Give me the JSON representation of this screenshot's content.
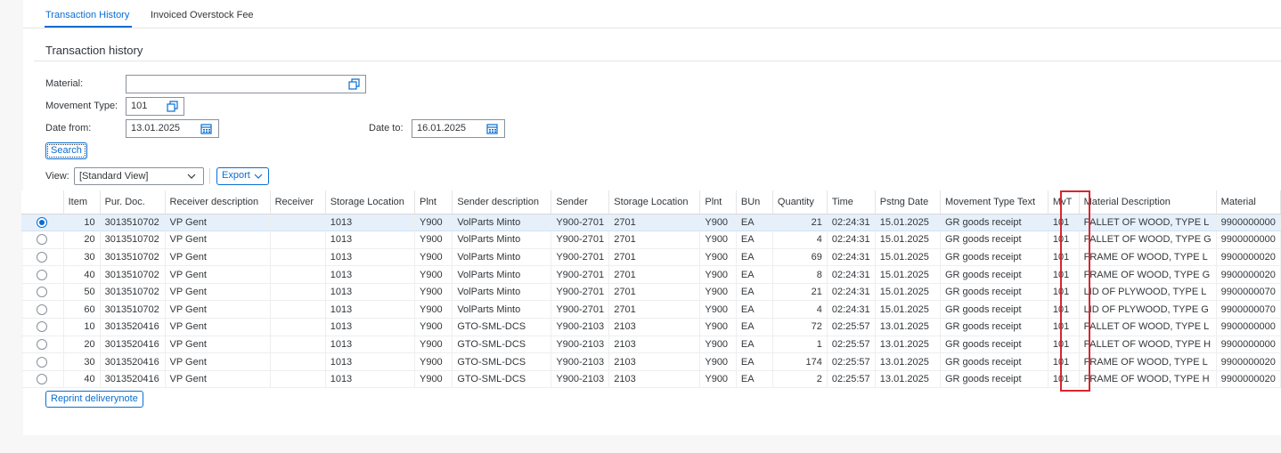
{
  "tabs": [
    {
      "label": "Transaction History",
      "active": true
    },
    {
      "label": "Invoiced Overstock Fee",
      "active": false
    }
  ],
  "section_title": "Transaction history",
  "form": {
    "material_label": "Material:",
    "material_value": "",
    "movement_type_label": "Movement Type:",
    "movement_type_value": "101",
    "date_from_label": "Date from:",
    "date_from_value": "13.01.2025",
    "date_to_label": "Date to:",
    "date_to_value": "16.01.2025",
    "search_label": "Search"
  },
  "toolbar": {
    "view_label": "View:",
    "view_value": "[Standard View]",
    "export_label": "Export"
  },
  "columns": [
    "Item",
    "Pur. Doc.",
    "Receiver description",
    "Receiver",
    "Storage Location",
    "Plnt",
    "Sender description",
    "Sender",
    "Storage Location",
    "Plnt",
    "BUn",
    "Quantity",
    "Time",
    "Pstng Date",
    "Movement Type Text",
    "MvT",
    "Material Description",
    "Material"
  ],
  "rows": [
    [
      "10",
      "3013510702",
      "VP Gent",
      "",
      "1013",
      "Y900",
      "VolParts Minto",
      "Y900-2701",
      "2701",
      "Y900",
      "EA",
      "21",
      "02:24:31",
      "15.01.2025",
      "GR goods receipt",
      "101",
      "PALLET OF WOOD, TYPE L",
      "9900000000"
    ],
    [
      "20",
      "3013510702",
      "VP Gent",
      "",
      "1013",
      "Y900",
      "VolParts Minto",
      "Y900-2701",
      "2701",
      "Y900",
      "EA",
      "4",
      "02:24:31",
      "15.01.2025",
      "GR goods receipt",
      "101",
      "PALLET OF WOOD, TYPE G",
      "9900000000"
    ],
    [
      "30",
      "3013510702",
      "VP Gent",
      "",
      "1013",
      "Y900",
      "VolParts Minto",
      "Y900-2701",
      "2701",
      "Y900",
      "EA",
      "69",
      "02:24:31",
      "15.01.2025",
      "GR goods receipt",
      "101",
      "FRAME OF WOOD, TYPE L",
      "9900000020"
    ],
    [
      "40",
      "3013510702",
      "VP Gent",
      "",
      "1013",
      "Y900",
      "VolParts Minto",
      "Y900-2701",
      "2701",
      "Y900",
      "EA",
      "8",
      "02:24:31",
      "15.01.2025",
      "GR goods receipt",
      "101",
      "FRAME OF WOOD, TYPE G",
      "9900000020"
    ],
    [
      "50",
      "3013510702",
      "VP Gent",
      "",
      "1013",
      "Y900",
      "VolParts Minto",
      "Y900-2701",
      "2701",
      "Y900",
      "EA",
      "21",
      "02:24:31",
      "15.01.2025",
      "GR goods receipt",
      "101",
      "LID OF PLYWOOD, TYPE L",
      "9900000070"
    ],
    [
      "60",
      "3013510702",
      "VP Gent",
      "",
      "1013",
      "Y900",
      "VolParts Minto",
      "Y900-2701",
      "2701",
      "Y900",
      "EA",
      "4",
      "02:24:31",
      "15.01.2025",
      "GR goods receipt",
      "101",
      "LID OF PLYWOOD, TYPE G",
      "9900000070"
    ],
    [
      "10",
      "3013520416",
      "VP Gent",
      "",
      "1013",
      "Y900",
      "GTO-SML-DCS",
      "Y900-2103",
      "2103",
      "Y900",
      "EA",
      "72",
      "02:25:57",
      "13.01.2025",
      "GR goods receipt",
      "101",
      "PALLET OF WOOD, TYPE L",
      "9900000000"
    ],
    [
      "20",
      "3013520416",
      "VP Gent",
      "",
      "1013",
      "Y900",
      "GTO-SML-DCS",
      "Y900-2103",
      "2103",
      "Y900",
      "EA",
      "1",
      "02:25:57",
      "13.01.2025",
      "GR goods receipt",
      "101",
      "PALLET OF WOOD, TYPE H",
      "9900000000"
    ],
    [
      "30",
      "3013520416",
      "VP Gent",
      "",
      "1013",
      "Y900",
      "GTO-SML-DCS",
      "Y900-2103",
      "2103",
      "Y900",
      "EA",
      "174",
      "02:25:57",
      "13.01.2025",
      "GR goods receipt",
      "101",
      "FRAME OF WOOD, TYPE L",
      "9900000020"
    ],
    [
      "40",
      "3013520416",
      "VP Gent",
      "",
      "1013",
      "Y900",
      "GTO-SML-DCS",
      "Y900-2103",
      "2103",
      "Y900",
      "EA",
      "2",
      "02:25:57",
      "13.01.2025",
      "GR goods receipt",
      "101",
      "FRAME OF WOOD, TYPE H",
      "9900000020"
    ]
  ],
  "selected_row": 0,
  "reprint_label": "Reprint deliverynote",
  "colors": {
    "accent": "#0a6ed1",
    "highlight": "#d9262e",
    "selected_row": "#e5f0fa"
  },
  "icons": {
    "value_help": "value-help-icon",
    "calendar": "calendar-icon",
    "dropdown": "chevron-down-icon"
  }
}
